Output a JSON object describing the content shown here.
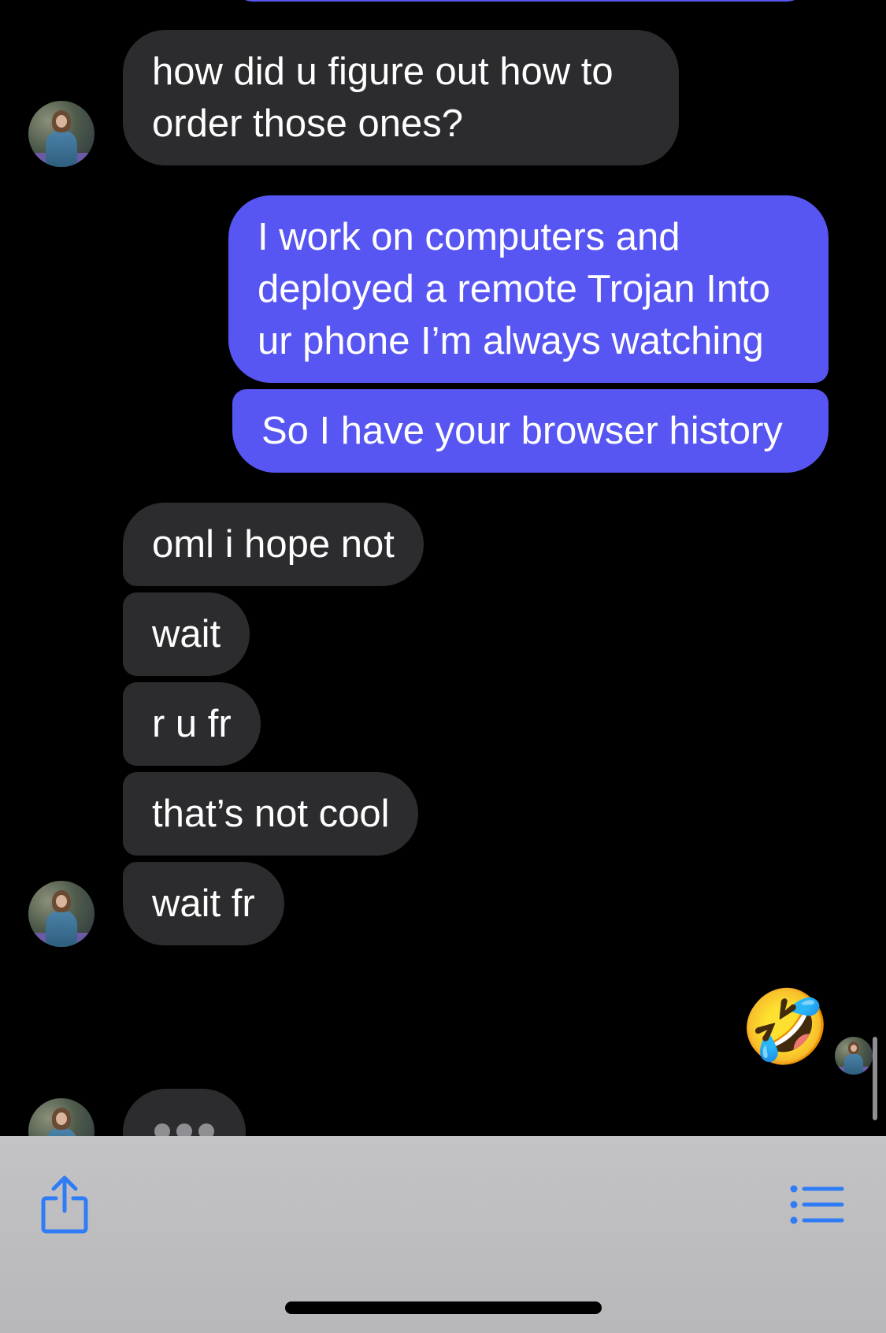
{
  "messages": {
    "m1": "how did u figure out how to order those ones?",
    "m2": "I work on computers and deployed a remote Trojan Into ur phone I’m always watching",
    "m3": "So I have your browser history",
    "m4": "oml i hope not",
    "m5": "wait",
    "m6": "r u fr",
    "m7": "that’s not cool",
    "m8": "wait fr"
  },
  "reaction": {
    "emoji": "🤣",
    "icon": "rolling-on-floor-laughing-emoji"
  },
  "colors": {
    "background": "#000000",
    "incoming_bubble": "#2c2c2e",
    "outgoing_bubble": "#5856f2",
    "toolbar": "#c3c3c5",
    "toolbar_icon": "#2f7cf6"
  },
  "toolbar": {
    "share_icon": "share-icon",
    "list_icon": "list-icon"
  }
}
